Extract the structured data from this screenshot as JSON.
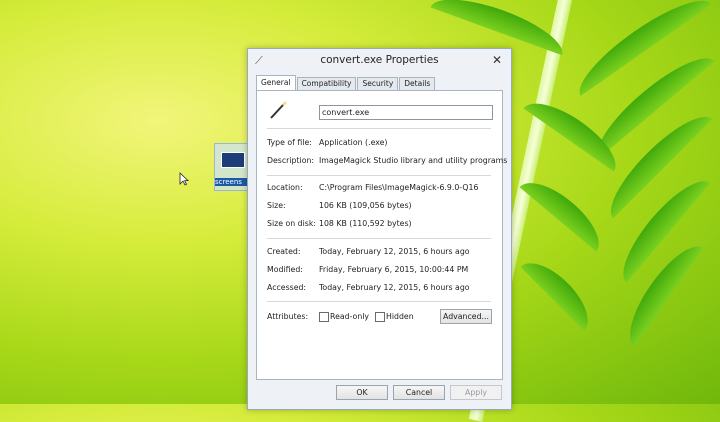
{
  "dialog": {
    "title": "convert.exe Properties",
    "close_glyph": "✕",
    "tabs": [
      {
        "label": "General",
        "active": true
      },
      {
        "label": "Compatibility",
        "active": false
      },
      {
        "label": "Security",
        "active": false
      },
      {
        "label": "Details",
        "active": false
      }
    ],
    "file_name": "convert.exe",
    "icon": "magic-wand-icon",
    "properties": {
      "type_of_file": {
        "label": "Type of file:",
        "value": "Application (.exe)"
      },
      "description": {
        "label": "Description:",
        "value": "ImageMagick Studio library and utility programs"
      },
      "location": {
        "label": "Location:",
        "value": "C:\\Program Files\\ImageMagick-6.9.0-Q16"
      },
      "size": {
        "label": "Size:",
        "value": "106 KB (109,056 bytes)"
      },
      "size_on_disk": {
        "label": "Size on disk:",
        "value": "108 KB (110,592 bytes)"
      },
      "created": {
        "label": "Created:",
        "value": "Today, February 12, 2015, 6 hours ago"
      },
      "modified": {
        "label": "Modified:",
        "value": "Friday, February 6, 2015, 10:00:44 PM"
      },
      "accessed": {
        "label": "Accessed:",
        "value": "Today, February 12, 2015, 6 hours ago"
      }
    },
    "attributes": {
      "label": "Attributes:",
      "read_only": {
        "label": "Read-only",
        "checked": false
      },
      "hidden": {
        "label": "Hidden",
        "checked": false
      },
      "advanced_button": "Advanced..."
    },
    "buttons": {
      "ok": "OK",
      "cancel": "Cancel",
      "apply": "Apply"
    }
  },
  "desktop": {
    "icon_label": "screens"
  }
}
